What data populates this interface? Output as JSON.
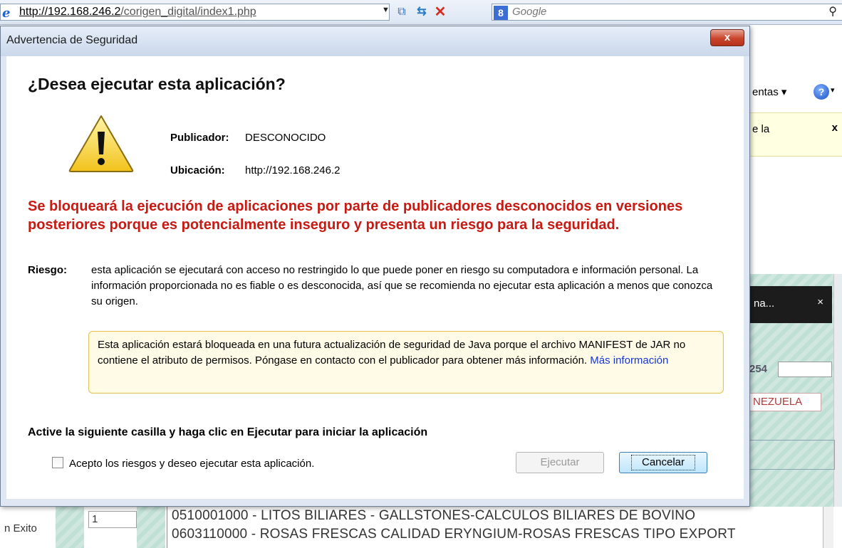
{
  "browser": {
    "url_host": "http://192.168.246.2",
    "url_path": "/corigen_digital/index1.php",
    "search_placeholder": "Google",
    "tools_label": "entas ▾",
    "infobar_text": "e la",
    "infobar_close": "x",
    "popup_text": "na...",
    "popup_close": "×",
    "field_value": "254",
    "country_text": "NEZUELA",
    "status_text": "n Exito",
    "row_number": "1",
    "list_items": [
      "0510001000 - LITOS BILIARES - GALLSTONES-CALCULOS BILIARES DE BOVINO",
      "0603110000 - ROSAS FRESCAS CALIDAD ERYNGIUM-ROSAS FRESCAS TIPO EXPORT"
    ]
  },
  "dialog": {
    "title": "Advertencia de Seguridad",
    "close_label": "x",
    "heading": "¿Desea ejecutar esta aplicación?",
    "publisher_label": "Publicador:",
    "publisher_value": "DESCONOCIDO",
    "location_label": "Ubicación:",
    "location_value": "http://192.168.246.2",
    "warning_message": "Se bloqueará la ejecución de aplicaciones por parte de publicadores desconocidos en versiones posteriores porque es potencialmente inseguro y presenta un riesgo para la seguridad.",
    "risk_label": "Riesgo:",
    "risk_text": "esta aplicación se ejecutará con acceso no restringido lo que puede poner en riesgo su computadora e información personal. La información proporcionada no es fiable o es desconocida, así que se recomienda no ejecutar esta aplicación a menos que conozca su origen.",
    "note_text": "Esta aplicación estará bloqueada en una futura actualización de seguridad de Java porque el archivo MANIFEST de JAR no contiene el atributo de permisos. Póngase en contacto con el publicador para obtener más información.",
    "note_link": "Más información",
    "instruction": "Active la siguiente casilla y haga clic en Ejecutar para iniciar la aplicación",
    "checkbox_label": "Acepto los riesgos y deseo ejecutar esta aplicación.",
    "run_button": "Ejecutar",
    "cancel_button": "Cancelar"
  },
  "colors": {
    "warning_red": "#c81a12",
    "link_blue": "#1636d6",
    "note_bg": "#fffbe6",
    "note_border": "#e2c35e"
  }
}
